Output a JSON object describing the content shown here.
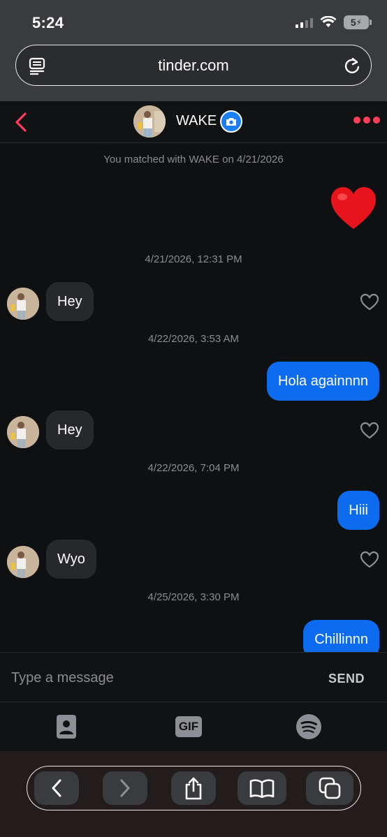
{
  "status_bar": {
    "time": "5:24",
    "battery": "5"
  },
  "browser": {
    "url": "tinder.com"
  },
  "chat_header": {
    "name": "WAKE"
  },
  "conversation": {
    "match_notice": "You matched with WAKE on 4/21/2026",
    "timestamps": [
      "4/21/2026, 12:31 PM",
      "4/22/2026, 3:53 AM",
      "4/22/2026, 7:04 PM",
      "4/25/2026, 3:30 PM"
    ],
    "incoming": [
      "Hey",
      "Hey",
      "Wyo"
    ],
    "outgoing": [
      "Hola againnnn",
      "Hiii",
      "Chillinnn"
    ],
    "heart_emoji": "❤️"
  },
  "composer": {
    "placeholder": "Type a message",
    "send_label": "SEND"
  },
  "toolbar": {
    "gif_label": "GIF"
  },
  "colors": {
    "accent": "#ff3d5a",
    "outgoing_bubble": "#0c6bef",
    "incoming_bubble": "#27282c",
    "verified": "#1a7ff5"
  },
  "icons": [
    "reader-icon",
    "reload-icon",
    "back-chevron-icon",
    "camera-icon",
    "more-dots-icon",
    "heart-like-icon",
    "contact-card-icon",
    "gif-icon",
    "spotify-icon",
    "share-icon",
    "bookmarks-icon",
    "tabs-icon"
  ]
}
